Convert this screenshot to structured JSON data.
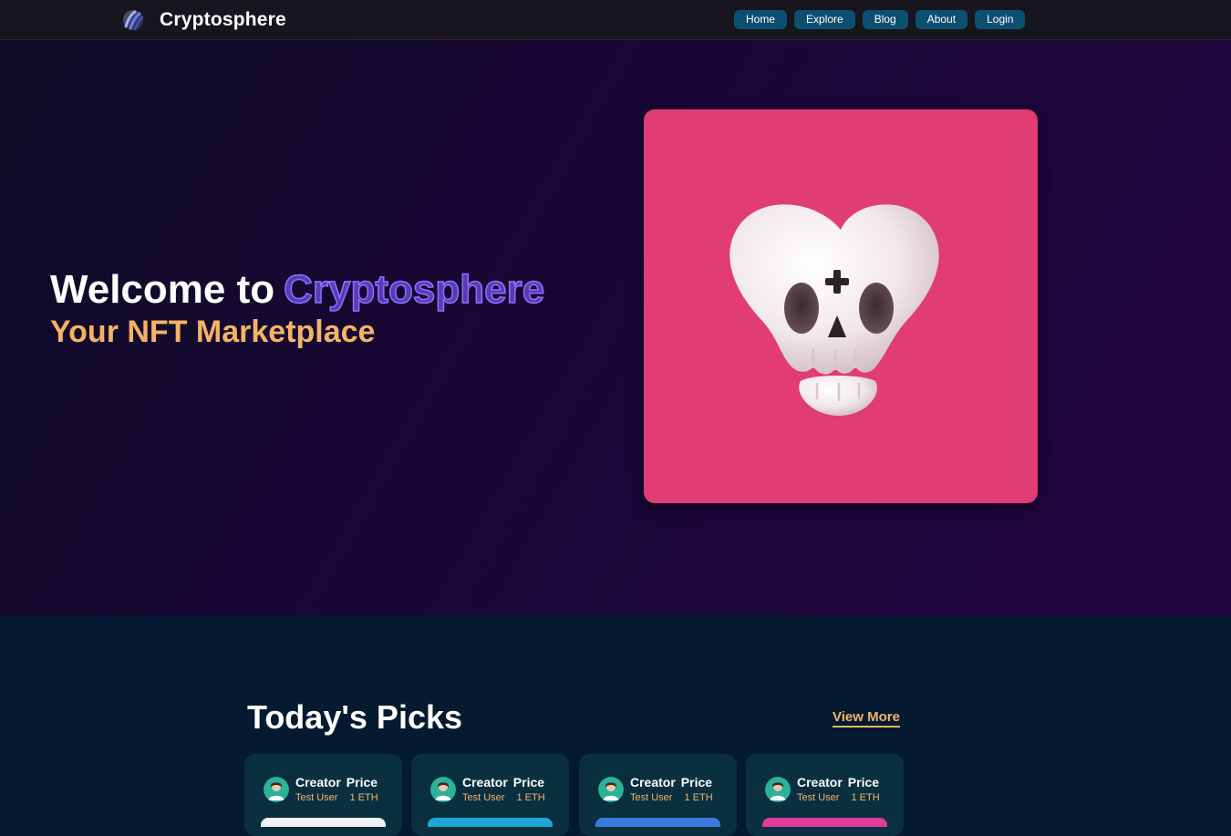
{
  "nav": {
    "brand": "Cryptosphere",
    "links": [
      "Home",
      "Explore",
      "Blog",
      "About",
      "Login"
    ],
    "button_color": "#0d4f71"
  },
  "hero": {
    "title_prefix": "Welcome to",
    "title_highlight": "Cryptosphere",
    "subtitle": "Your NFT Marketplace",
    "card_color": "#e13c73",
    "image": "heart-skull-3d-icon"
  },
  "picks": {
    "title": "Today's Picks",
    "view_more": "View More",
    "cards": [
      {
        "creator_label": "Creator",
        "price_label": "Price",
        "creator": "Test User",
        "price": "1 ETH",
        "accent": "#f2f2f2"
      },
      {
        "creator_label": "Creator",
        "price_label": "Price",
        "creator": "Test User",
        "price": "1 ETH",
        "accent": "#1fa6d9"
      },
      {
        "creator_label": "Creator",
        "price_label": "Price",
        "creator": "Test User",
        "price": "1 ETH",
        "accent": "#3a7be0"
      },
      {
        "creator_label": "Creator",
        "price_label": "Price",
        "creator": "Test User",
        "price": "1 ETH",
        "accent": "#e13c9a"
      }
    ]
  },
  "colors": {
    "accent_orange": "#f6b266",
    "outline_purple": "#8b72ff",
    "hero_gradient_start": "#0f0c27",
    "hero_gradient_end": "#230442",
    "section_bg": "#031a30"
  }
}
